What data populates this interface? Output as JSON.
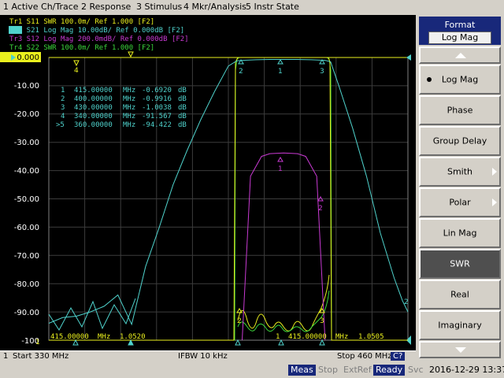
{
  "colors": {
    "cyan": "#4fd2cc",
    "yellow": "#eaf01e",
    "magenta": "#c83ad2",
    "green": "#3bd63b",
    "grid": "#3c3c3c"
  },
  "menu": [
    "1 Active Ch/Trace",
    "2 Response",
    "3 Stimulus",
    "4 Mkr/Analysis",
    "5 Instr State"
  ],
  "traces": [
    {
      "id": "Tr1",
      "label": "Tr1  S11  SWR 100.0m/ Ref 1.000  [F2]",
      "color": "yellow"
    },
    {
      "id": "Tr2",
      "label": "Tr2  S21  Log Mag 10.00dB/ Ref 0.000dB  [F2]",
      "color": "cyan",
      "active": true
    },
    {
      "id": "Tr3",
      "label": "Tr3  S12  Log Mag 200.0mdB/ Ref 0.000dB  [F2]",
      "color": "magenta"
    },
    {
      "id": "Tr4",
      "label": "Tr4  S22  SWR 100.0m/ Ref 1.000  [F2]",
      "color": "green"
    }
  ],
  "y_ticks": [
    "0.000",
    "-10.00",
    "-20.00",
    "-30.00",
    "-40.00",
    "-50.00",
    "-60.00",
    "-70.00",
    "-80.00",
    "-90.00",
    "-100"
  ],
  "marker_table": [
    {
      "n": "1",
      "freq": "415.00000",
      "unit": "MHz",
      "val": "-0.6920",
      "vu": "dB"
    },
    {
      "n": "2",
      "freq": "400.00000",
      "unit": "MHz",
      "val": "-0.9916",
      "vu": "dB"
    },
    {
      "n": "3",
      "freq": "430.00000",
      "unit": "MHz",
      "val": "-1.0038",
      "vu": "dB"
    },
    {
      "n": "4",
      "freq": "340.00000",
      "unit": "MHz",
      "val": "-91.567",
      "vu": "dB"
    },
    {
      "n": ">5",
      "freq": "360.00000",
      "unit": "MHz",
      "val": "-94.422",
      "vu": "dB"
    }
  ],
  "bottom_markers": {
    "left": {
      "freq": "415.00000",
      "unit": "MHz",
      "val": "1.0520"
    },
    "right": {
      "ref": "1",
      "freq": "415.00000",
      "unit": "MHz",
      "val": "1.0505"
    }
  },
  "marker_tags": {
    "m1": "1",
    "m2": "2",
    "m3": "3",
    "m4": "4",
    "m5": "5",
    "r2": "2",
    "ref1": "1",
    "bm2": "2",
    "bm3": "3"
  },
  "softkeys": {
    "header_title": "Format",
    "header_value": "Log Mag",
    "items": [
      "Log Mag",
      "Phase",
      "Group Delay",
      "Smith",
      "Polar",
      "Lin Mag",
      "SWR",
      "Real",
      "Imaginary"
    ]
  },
  "channel_bar": {
    "ch": "1",
    "start": "Start 330 MHz",
    "ifbw": "IFBW 10 kHz",
    "stop": "Stop 460 MHz",
    "c": "C?"
  },
  "status": {
    "meas": "Meas",
    "stop": "Stop",
    "extref": "ExtRef",
    "ready": "Ready",
    "svc": "Svc",
    "datetime": "2016-12-29 13:37"
  },
  "chart_data": {
    "type": "line",
    "xlabel": "",
    "ylabel": "",
    "x_range_mhz": [
      330,
      460
    ],
    "ylim": [
      -100,
      0
    ],
    "series": [
      {
        "name": "S21 Log Mag",
        "color": "cyan",
        "x": [
          330,
          335,
          340,
          345,
          350,
          355,
          360,
          365,
          370,
          375,
          380,
          385,
          390,
          395,
          398,
          400,
          405,
          410,
          415,
          420,
          425,
          430,
          432,
          435,
          440,
          445,
          450,
          455,
          458,
          460
        ],
        "values": [
          -94,
          -92,
          -91.5,
          -90,
          -88,
          -84,
          -94.4,
          -74,
          -60,
          -45,
          -33,
          -22,
          -12,
          -3,
          -1.2,
          -1.0,
          -0.8,
          -0.7,
          -0.69,
          -0.7,
          -0.8,
          -1.0,
          -1.5,
          -10,
          -25,
          -42,
          -62,
          -78,
          -86,
          -90
        ]
      },
      {
        "name": "S12 Log Mag",
        "color": "magenta",
        "x": [
          400,
          403,
          407,
          410,
          415,
          420,
          423,
          427,
          430
        ],
        "values": [
          -100,
          -42,
          -35,
          -34,
          -33.8,
          -34,
          -35,
          -42,
          -100
        ]
      }
    ]
  }
}
